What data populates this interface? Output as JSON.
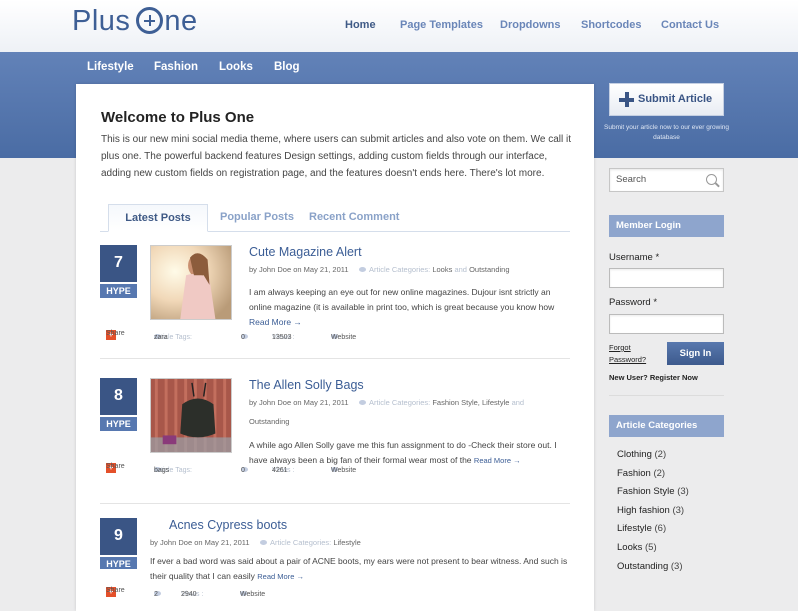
{
  "site": {
    "logo_prefix": "Plus",
    "logo_suffix": "ne"
  },
  "topnav": [
    {
      "label": "Home",
      "active": true
    },
    {
      "label": "Page Templates"
    },
    {
      "label": "Dropdowns"
    },
    {
      "label": "Shortcodes"
    },
    {
      "label": "Contact Us"
    }
  ],
  "catnav": [
    "Lifestyle",
    "Fashion",
    "Looks",
    "Blog"
  ],
  "welcome": {
    "title": "Welcome to Plus One",
    "text": "This is our new mini social media theme, where users can submit articles and also vote on them. We call it plus one. The powerful backend features Design settings, adding custom fields through our interface, adding new custom fields on registration page, and the features doesn't ends here. There's lot more."
  },
  "tabs": [
    "Latest Posts",
    "Popular Posts",
    "Recent Comment"
  ],
  "post_labels": {
    "hype": "HYPE",
    "by": "by",
    "on": "on",
    "categories": "Article Categories:",
    "tags": "Article Tags:",
    "views": "Views :",
    "website": "Website",
    "share": "Share",
    "read_more": "Read More →",
    "and": "and"
  },
  "posts": [
    {
      "votes": "7",
      "title": "Cute Magazine Alert",
      "author": "John Doe",
      "date": "May 21, 2011",
      "cat1": "Looks",
      "cat2": "Outstanding",
      "excerpt": "I am always keeping an eye out for new online magazines. Dujour isnt strictly an online magazine (it is available in print too, which is great because you know how",
      "tags": "zara",
      "comments": "0",
      "views": "13503"
    },
    {
      "votes": "8",
      "title": "The Allen Solly Bags",
      "author": "John Doe",
      "date": "May 21, 2011",
      "cat1": "Fashion Style",
      "cat2": "Lifestyle",
      "cat3": "Outstanding",
      "excerpt": "A while ago Allen Solly gave me this fun assignment to do -Check their store out. I have always been a big fan of their formal wear most of the",
      "tags": "bags",
      "comments": "0",
      "views": "4261"
    },
    {
      "votes": "9",
      "title": "Acnes Cypress boots",
      "author": "John Doe",
      "date": "May 21, 2011",
      "cat1": "Lifestyle",
      "excerpt": "If ever a bad word was said about a pair of ACNE boots, my ears were not present to bear witness. And such is their quality that I can easily",
      "comments": "2",
      "views": "2940"
    }
  ],
  "sidebar": {
    "submit_label": "Submit Article",
    "submit_note": "Submit your article now to our ever growing database",
    "search_placeholder": "Search",
    "login_title": "Member Login",
    "username_label": "Username *",
    "password_label": "Password *",
    "forgot_line1": "Forgot",
    "forgot_line2": "Password?",
    "signin_label": "Sign In",
    "new_user": "New User? Register Now",
    "categories_title": "Article Categories",
    "categories": [
      {
        "name": "Clothing",
        "count": "(2)"
      },
      {
        "name": "Fashion",
        "count": "(2)"
      },
      {
        "name": "Fashion Style",
        "count": "(3)"
      },
      {
        "name": "High fashion",
        "count": "(3)"
      },
      {
        "name": "Lifestyle",
        "count": "(6)"
      },
      {
        "name": "Looks",
        "count": "(5)"
      },
      {
        "name": "Outstanding",
        "count": "(3)"
      }
    ]
  },
  "colors": {
    "brand": "#3e5f95",
    "band": "#5677ae",
    "hype_dark": "#3a5585",
    "hype_light": "#5778b0",
    "widget_header": "#8ea5cd",
    "link": "#3b5d95"
  }
}
